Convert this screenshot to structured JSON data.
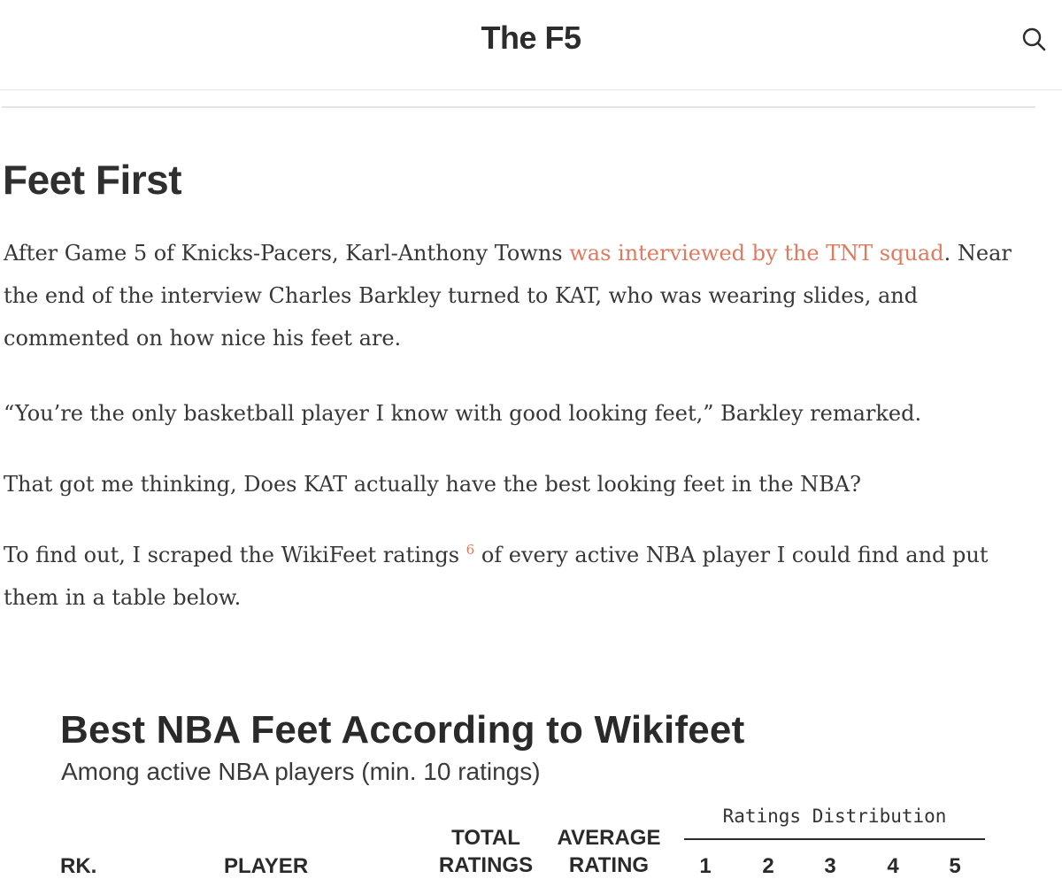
{
  "header": {
    "site_title": "The F5",
    "search_icon": "search-icon"
  },
  "post": {
    "title": "Feet First",
    "p1": {
      "before": "After Game 5 of Knicks-Pacers, Karl-Anthony Towns ",
      "link": "was interviewed by the TNT squad",
      "after": ". Near the end of the interview Charles Barkley turned to KAT, who was wearing slides, and commented on how nice his feet are."
    },
    "p2": "“You’re the only basketball player I know with good looking feet,” Barkley remarked.",
    "p3": "That got me thinking, Does KAT actually have the best looking feet in the NBA?",
    "p4": {
      "before": "To find out, I scraped the WikiFeet ratings ",
      "footnote": "6",
      "after": " of every active NBA player I could find and put them in a table below."
    }
  },
  "colors": {
    "link": "#e07a5f",
    "text": "#363737"
  },
  "chart": {
    "title": "Best NBA Feet According to Wikifeet",
    "subtitle": "Among active NBA players (min. 10 ratings)",
    "distribution_label": "Ratings Distribution",
    "columns": {
      "rank": "RK.",
      "player": "PLAYER",
      "total_line1": "TOTAL",
      "total_line2": "RATINGS",
      "average_line1": "AVERAGE",
      "average_line2": "RATING",
      "ratings": [
        "1",
        "2",
        "3",
        "4",
        "5"
      ]
    }
  }
}
